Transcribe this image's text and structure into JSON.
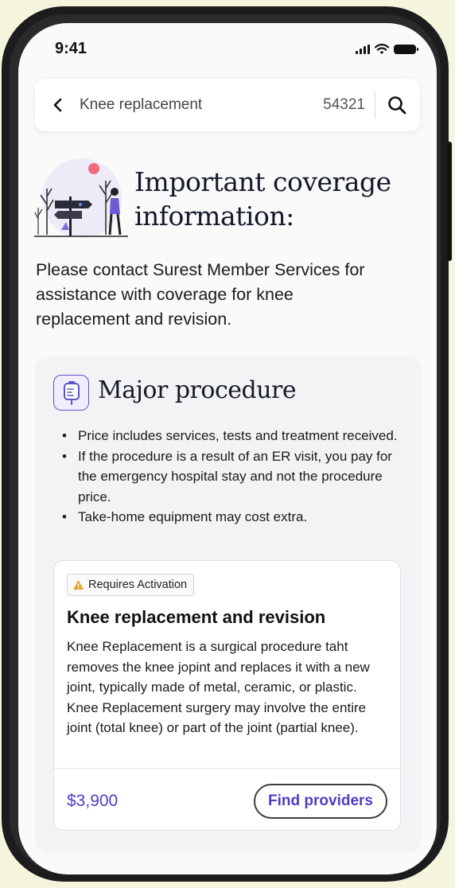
{
  "status_bar": {
    "time": "9:41"
  },
  "search": {
    "query": "Knee replacement",
    "zip": "54321"
  },
  "heading": {
    "title_line1": "Important coverage",
    "title_line2": "information:",
    "intro": "Please contact Surest Member Services for assistance with coverage for knee replacement and revision."
  },
  "card": {
    "title": "Major procedure",
    "bullets": [
      "Price includes services, tests and treatment received.",
      "If the procedure is a result of an ER visit, you pay for the emergency hospital stay and not the procedure price.",
      "Take-home equipment may cost extra."
    ],
    "procedure": {
      "badge": "Requires Activation",
      "name": "Knee replacement and revision",
      "description": "Knee Replacement is a surgical procedure taht removes the knee jopint and replaces it with a new joint, typically made of metal, ceramic, or plastic. Knee Replacement surgery may involve the entire joint (total knee) or part of the joint (partial knee).",
      "price": "$3,900",
      "button_label": "Find providers"
    }
  },
  "colors": {
    "accent": "#4b3fc4",
    "warning": "#f0a030",
    "background": "#f4f5dc"
  },
  "icons": [
    "back-chevron-icon",
    "search-icon",
    "signal-icon",
    "wifi-icon",
    "battery-icon",
    "iv-bag-icon",
    "warning-icon"
  ]
}
